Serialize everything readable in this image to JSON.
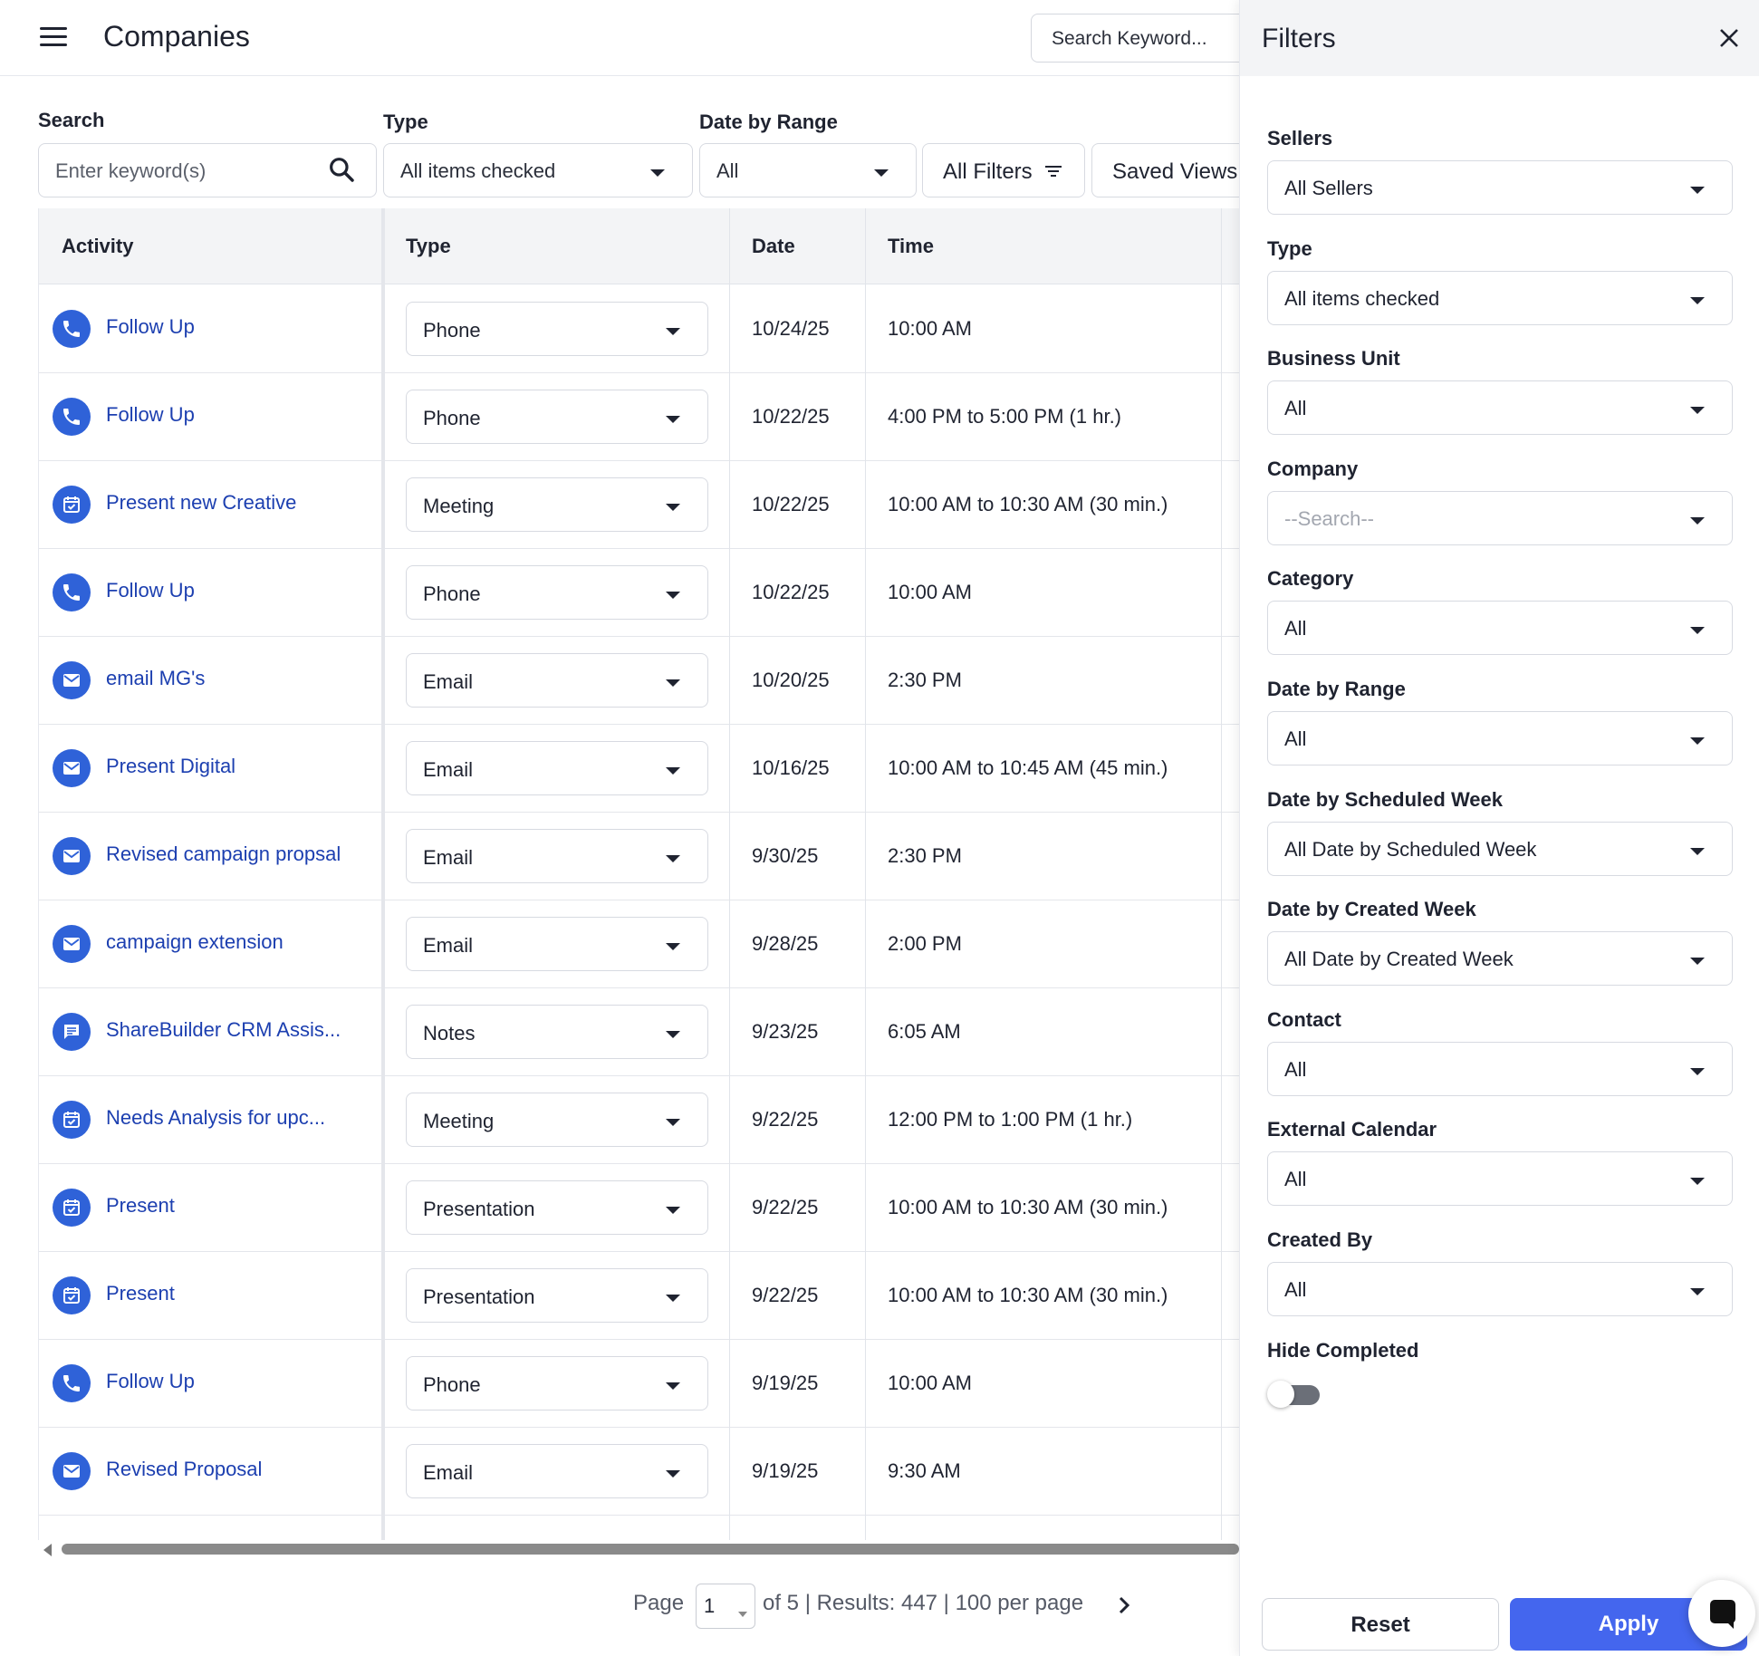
{
  "header": {
    "title": "Companies",
    "search_keyword": "Search Keyword..."
  },
  "filters_bar": {
    "search_label": "Search",
    "search_placeholder": "Enter keyword(s)",
    "type_label": "Type",
    "type_value": "All items checked",
    "date_label": "Date by Range",
    "date_value": "All",
    "all_filters": "All Filters",
    "saved_views": "Saved Views"
  },
  "table": {
    "columns": [
      "Activity",
      "Type",
      "Date",
      "Time"
    ],
    "rows": [
      {
        "icon": "phone-icon",
        "activity": "Follow Up",
        "type": "Phone",
        "date": "10/24/25",
        "time": "10:00 AM"
      },
      {
        "icon": "phone-icon",
        "activity": "Follow Up",
        "type": "Phone",
        "date": "10/22/25",
        "time": "4:00 PM to 5:00 PM (1 hr.)"
      },
      {
        "icon": "calendar-icon",
        "activity": "Present new Creative",
        "type": "Meeting",
        "date": "10/22/25",
        "time": "10:00 AM to 10:30 AM (30 min.)"
      },
      {
        "icon": "phone-icon",
        "activity": "Follow Up",
        "type": "Phone",
        "date": "10/22/25",
        "time": "10:00 AM"
      },
      {
        "icon": "email-icon",
        "activity": "email MG's",
        "type": "Email",
        "date": "10/20/25",
        "time": "2:30 PM"
      },
      {
        "icon": "email-icon",
        "activity": "Present Digital",
        "type": "Email",
        "date": "10/16/25",
        "time": "10:00 AM to 10:45 AM (45 min.)"
      },
      {
        "icon": "email-icon",
        "activity": "Revised campaign propsal",
        "type": "Email",
        "date": "9/30/25",
        "time": "2:30 PM"
      },
      {
        "icon": "email-icon",
        "activity": "campaign extension",
        "type": "Email",
        "date": "9/28/25",
        "time": "2:00 PM"
      },
      {
        "icon": "notes-icon",
        "activity": "ShareBuilder CRM Assis...",
        "type": "Notes",
        "date": "9/23/25",
        "time": "6:05 AM"
      },
      {
        "icon": "calendar-icon",
        "activity": "Needs Analysis for upc...",
        "type": "Meeting",
        "date": "9/22/25",
        "time": "12:00 PM to 1:00 PM (1 hr.)"
      },
      {
        "icon": "calendar-icon",
        "activity": "Present",
        "type": "Presentation",
        "date": "9/22/25",
        "time": "10:00 AM to 10:30 AM (30 min.)"
      },
      {
        "icon": "calendar-icon",
        "activity": "Present",
        "type": "Presentation",
        "date": "9/22/25",
        "time": "10:00 AM to 10:30 AM (30 min.)"
      },
      {
        "icon": "phone-icon",
        "activity": "Follow Up",
        "type": "Phone",
        "date": "9/19/25",
        "time": "10:00 AM"
      },
      {
        "icon": "email-icon",
        "activity": "Revised Proposal",
        "type": "Email",
        "date": "9/19/25",
        "time": "9:30 AM"
      }
    ]
  },
  "pagination": {
    "page_label": "Page",
    "page_value": "1",
    "summary": "of 5 | Results: 447 | 100 per page"
  },
  "drawer": {
    "title": "Filters",
    "fields": [
      {
        "label": "Sellers",
        "value": "All Sellers"
      },
      {
        "label": "Type",
        "value": "All items checked"
      },
      {
        "label": "Business Unit",
        "value": "All"
      },
      {
        "label": "Company",
        "value": "--Search--",
        "placeholder": true
      },
      {
        "label": "Category",
        "value": "All"
      },
      {
        "label": "Date by Range",
        "value": "All"
      },
      {
        "label": "Date by Scheduled Week",
        "value": "All Date by Scheduled Week"
      },
      {
        "label": "Date by Created Week",
        "value": "All Date by Created Week"
      },
      {
        "label": "Contact",
        "value": "All"
      },
      {
        "label": "External Calendar",
        "value": "All"
      },
      {
        "label": "Created By",
        "value": "All"
      }
    ],
    "hide_completed_label": "Hide Completed",
    "hide_completed": false,
    "reset_label": "Reset",
    "apply_label": "Apply"
  },
  "colors": {
    "accent": "#4466ee",
    "icon_circle": "#2f62d8",
    "link": "#1c3fb0",
    "header_bg": "#f3f4f6"
  }
}
